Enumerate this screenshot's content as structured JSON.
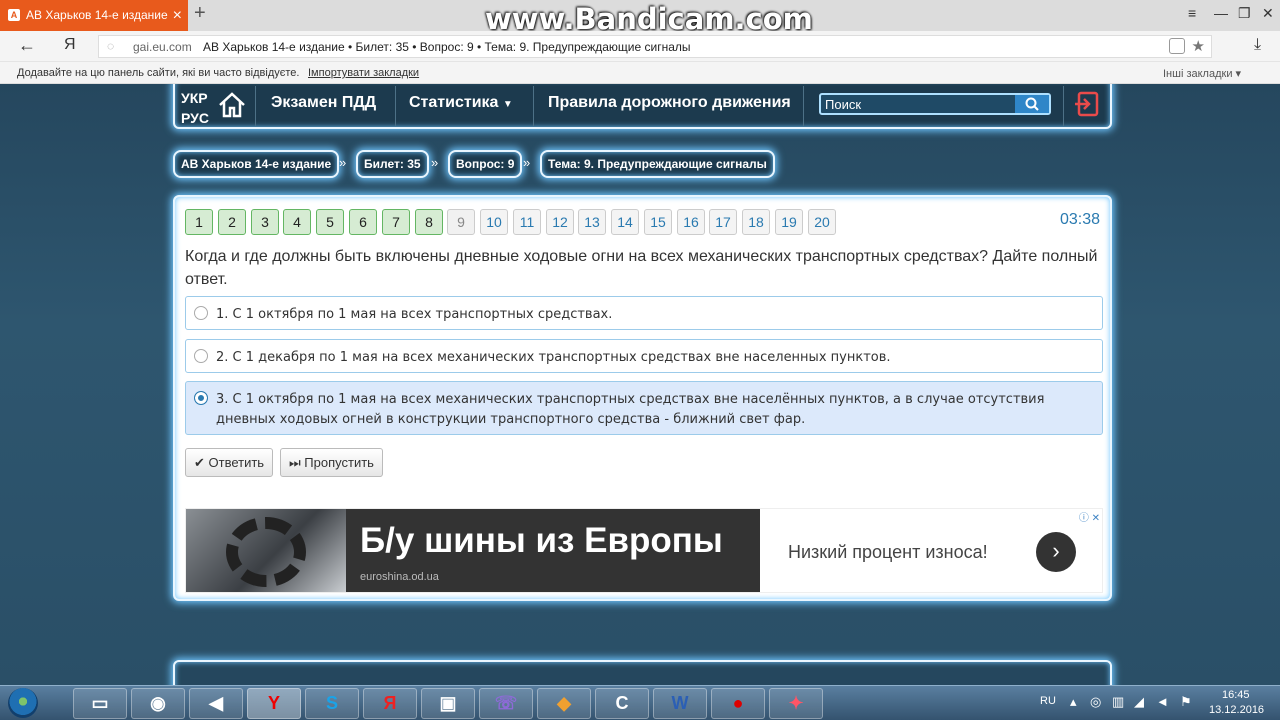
{
  "browser": {
    "tab_title": "АВ Харьков 14-е издание",
    "tab_favicon": "A",
    "tab_close": "×",
    "new_tab": "+",
    "watermark": "www.Bandicam.com",
    "window_controls": [
      "≡",
      "—",
      "❐",
      "✕"
    ],
    "back": "←",
    "yandex_logo": "Я",
    "url_domain": "gai.eu.com",
    "url_title": "АВ Харьков 14-е издание • Билет: 35 • Вопрос: 9 • Тема: 9. Предупреждающие сигналы",
    "download": "⤓",
    "bookmarks_msg": "Додавайте на цю панель сайти, які ви часто відвідуєте.",
    "bookmarks_import": "Імпортувати закладки",
    "bookmarks_other": "Інші закладки"
  },
  "nav": {
    "lang_ukr": "УКР",
    "lang_rus": "РУС",
    "exam": "Экзамен ПДД",
    "stats": "Статистика",
    "stats_caret": "▼",
    "rules": "Правила дорожного движения",
    "search_placeholder": "Поиск"
  },
  "breadcrumb": [
    "АВ Харьков 14-е издание",
    "Билет: 35",
    "Вопрос: 9",
    "Тема: 9. Предупреждающие сигналы"
  ],
  "breadcrumb_sep": "»",
  "quiz": {
    "numbers_done": [
      "1",
      "2",
      "3",
      "4",
      "5",
      "6",
      "7",
      "8"
    ],
    "number_current": "9",
    "numbers_todo": [
      "10",
      "11",
      "12",
      "13",
      "14",
      "15",
      "16",
      "17",
      "18",
      "19",
      "20"
    ],
    "timer": "03:38",
    "question": "Когда и где должны быть включены дневные ходовые огни на всех механических транспортных средствах? Дайте полный ответ.",
    "answers": [
      {
        "text": "1. С 1 октября по 1 мая на всех транспортных средствах.",
        "selected": false
      },
      {
        "text": "2. С 1 декабря по 1 мая на всех механических транспортных средствах вне населенных пунктов.",
        "selected": false
      },
      {
        "text": "3. С 1 октября по 1 мая на всех механических транспортных средствах вне населённых пунктов, а в случае отсутствия дневных ходовых огней в конструкции транспортного средства - ближний свет фар.",
        "selected": true
      }
    ],
    "answer_button": "✔ Ответить",
    "skip_button": "⏭ Пропустить"
  },
  "ad": {
    "headline": "Б/у шины из Европы",
    "url": "euroshina.od.ua",
    "subtext": "Низкий процент износа!",
    "arrow": "›",
    "info": "ⓘ ✕"
  },
  "taskbar": {
    "lang": "RU",
    "time": "16:45",
    "date": "13.12.2016"
  },
  "colors": {
    "accent": "#2a7ab0",
    "done_green": "#64b663",
    "tab_orange": "#e85a1c",
    "page_bg": "#2c4f66"
  }
}
